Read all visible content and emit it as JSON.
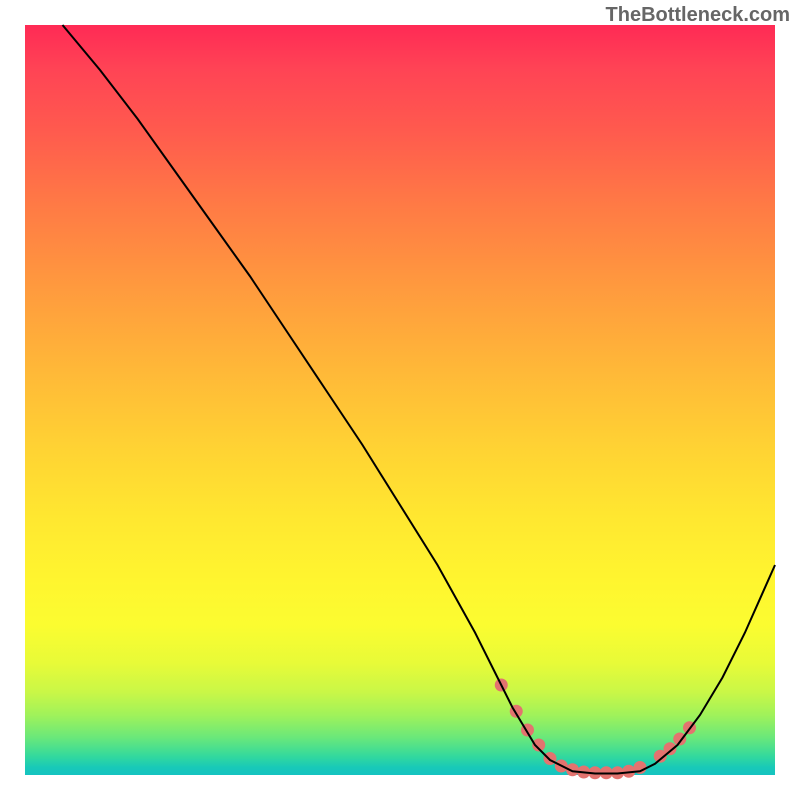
{
  "watermark": "TheBottleneck.com",
  "chart_data": {
    "type": "line",
    "title": "",
    "xlabel": "",
    "ylabel": "",
    "xlim": [
      0,
      100
    ],
    "ylim": [
      0,
      100
    ],
    "series": [
      {
        "name": "curve",
        "color": "#000000",
        "width": 2,
        "x": [
          5,
          10,
          15,
          20,
          25,
          30,
          35,
          40,
          45,
          50,
          55,
          60,
          63.5,
          65,
          68,
          70,
          73,
          76,
          79,
          82,
          84,
          87,
          90,
          93,
          96,
          100
        ],
        "y": [
          100,
          94,
          87.5,
          80.5,
          73.5,
          66.5,
          59,
          51.5,
          44,
          36,
          28,
          19,
          12,
          9,
          4,
          2,
          0.5,
          0.2,
          0.2,
          0.5,
          1.5,
          4,
          8,
          13,
          19,
          28
        ]
      },
      {
        "name": "marker-band",
        "type": "markers",
        "color": "#e3736f",
        "size": 13,
        "x": [
          63.5,
          65.5,
          67,
          68.5,
          70,
          71.5,
          73,
          74.5,
          76,
          77.5,
          79,
          80.5,
          82,
          84.7,
          86,
          87.3,
          88.6
        ],
        "y": [
          12,
          8.5,
          6,
          4,
          2.2,
          1.2,
          0.7,
          0.4,
          0.3,
          0.3,
          0.3,
          0.5,
          1.0,
          2.5,
          3.5,
          4.8,
          6.3
        ]
      }
    ],
    "background_gradient": {
      "type": "vertical",
      "stops": [
        {
          "pos": 0.0,
          "color": "#ff2a55"
        },
        {
          "pos": 0.24,
          "color": "#ff7a45"
        },
        {
          "pos": 0.57,
          "color": "#ffd433"
        },
        {
          "pos": 0.8,
          "color": "#fbfc30"
        },
        {
          "pos": 0.95,
          "color": "#6ae87a"
        },
        {
          "pos": 1.0,
          "color": "#15c3c1"
        }
      ]
    }
  }
}
